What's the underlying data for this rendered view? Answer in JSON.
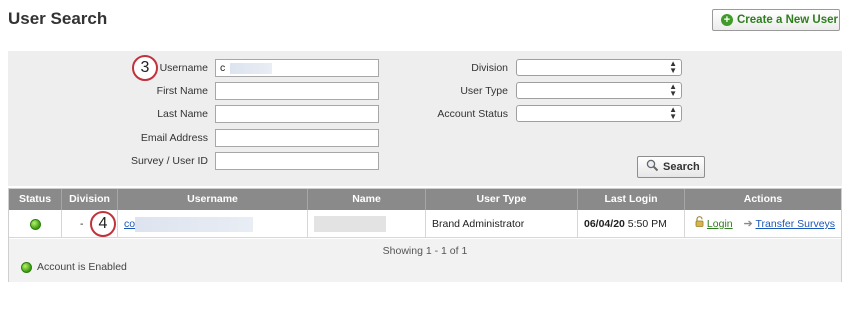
{
  "page": {
    "title": "User Search"
  },
  "header": {
    "create_button_label": "Create a New User"
  },
  "search_form": {
    "username_label": "Username",
    "username_value": "c",
    "first_name_label": "First Name",
    "last_name_label": "Last Name",
    "email_label": "Email Address",
    "survey_user_id_label": "Survey / User ID",
    "division_label": "Division",
    "user_type_label": "User Type",
    "account_status_label": "Account Status",
    "search_button_label": "Search"
  },
  "steps": {
    "step_username": "3",
    "step_row": "4"
  },
  "table": {
    "headers": [
      "Status",
      "Division",
      "Username",
      "Name",
      "User Type",
      "Last Login",
      "Actions"
    ],
    "rows": [
      {
        "division": "-",
        "username_prefix": "co",
        "user_type": "Brand Administrator",
        "last_login_date": "06/04/20",
        "last_login_time": "5:50 PM",
        "login_action": "Login",
        "transfer_action": "Transfer Surveys"
      }
    ],
    "showing_text": "Showing 1 - 1 of 1",
    "legend_text": "Account is Enabled"
  },
  "colors": {
    "accent_green": "#3f9c2a",
    "link_blue": "#1b57b8",
    "badge_red": "#c0323c",
    "header_gray": "#8a8a8a"
  }
}
